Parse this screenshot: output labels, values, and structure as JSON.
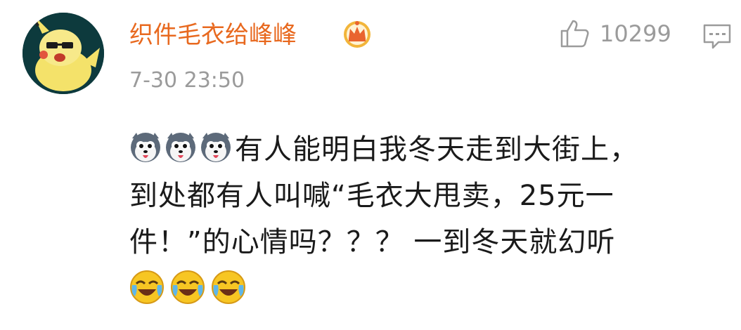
{
  "comment": {
    "author": "织件毛衣给峰峰",
    "timestamp": "7-30 23:50",
    "like_count": "10299",
    "text_line1": "有人能明白我冬天走到大街上，",
    "text_line2": "到处都有人叫喊“毛衣大甩卖，25元一",
    "text_line3": "件！”的心情吗？？？ 一到冬天就幻听",
    "leading_emojis": [
      "husky-emoji",
      "husky-emoji",
      "husky-emoji"
    ],
    "trailing_emojis": [
      "laugh-cry-emoji",
      "laugh-cry-emoji",
      "laugh-cry-emoji"
    ]
  },
  "colors": {
    "author": "#e8691f",
    "meta_gray": "#9b9b9b",
    "text": "#1a1a1a",
    "vip_gold": "#f2b53a"
  },
  "icons": {
    "avatar": "pikachu-avatar",
    "vip_badge": "crown-badge-icon",
    "like": "thumbs-up-icon",
    "comment": "comment-icon"
  }
}
